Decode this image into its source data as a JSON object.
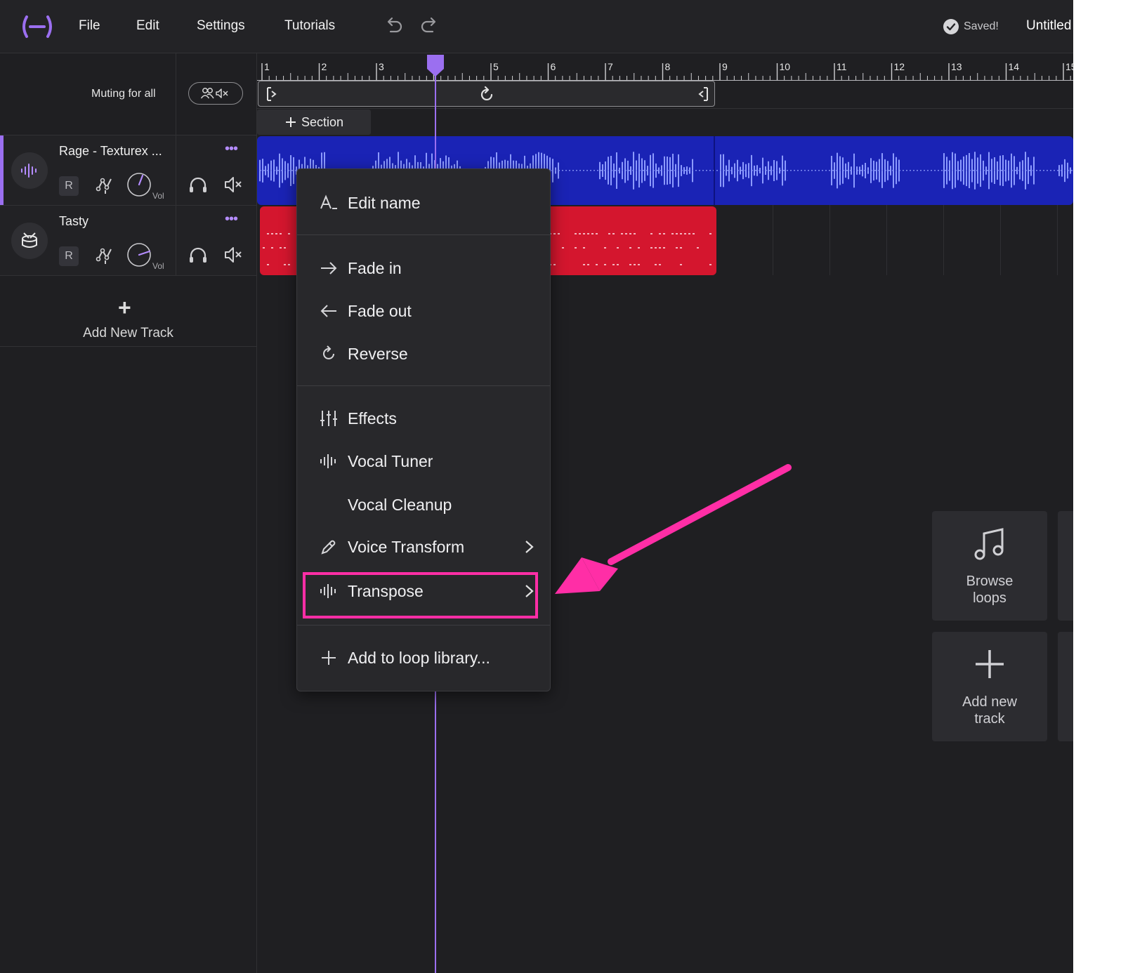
{
  "app": {
    "menu": [
      "File",
      "Edit",
      "Settings",
      "Tutorials"
    ],
    "saved_label": "Saved!",
    "doc_title": "Untitled"
  },
  "mixer": {
    "muting_label": "Muting for all"
  },
  "tracks": [
    {
      "name": "Rage - Texturex ...",
      "r_label": "R",
      "vol_label": "Vol",
      "clip_color": "#1a23b5"
    },
    {
      "name": "Tasty",
      "r_label": "R",
      "vol_label": "Vol",
      "clip_color": "#d4162e"
    }
  ],
  "add_track_label": "Add New Track",
  "timeline": {
    "ruler_numbers": [
      "1",
      "2",
      "3",
      "4",
      "5",
      "6",
      "7",
      "8",
      "9",
      "10",
      "11",
      "12",
      "13",
      "14",
      "15"
    ],
    "section_label": "Section",
    "accent": "#9b6ff0"
  },
  "context_menu": {
    "items": [
      {
        "label": "Edit name",
        "icon": "text-cursor-icon"
      },
      {
        "label": "Fade in",
        "icon": "arrow-right-icon"
      },
      {
        "label": "Fade out",
        "icon": "arrow-left-icon"
      },
      {
        "label": "Reverse",
        "icon": "reverse-icon"
      },
      {
        "label": "Effects",
        "icon": "sliders-icon"
      },
      {
        "label": "Vocal Tuner",
        "icon": "waveform-icon"
      },
      {
        "label": "Vocal Cleanup",
        "icon": ""
      },
      {
        "label": "Voice Transform",
        "icon": "pen-icon",
        "submenu": true
      },
      {
        "label": "Transpose",
        "icon": "waveform-icon",
        "submenu": true,
        "highlighted": true
      },
      {
        "label": "Add to loop library...",
        "icon": "plus-icon"
      }
    ],
    "highlight_color": "#ff2ea6"
  },
  "side_cards": [
    {
      "line1": "Browse",
      "line2": "loops",
      "icon": "music-note-icon"
    },
    {
      "line1": "Add new",
      "line2": "track",
      "icon": "plus-icon"
    }
  ]
}
